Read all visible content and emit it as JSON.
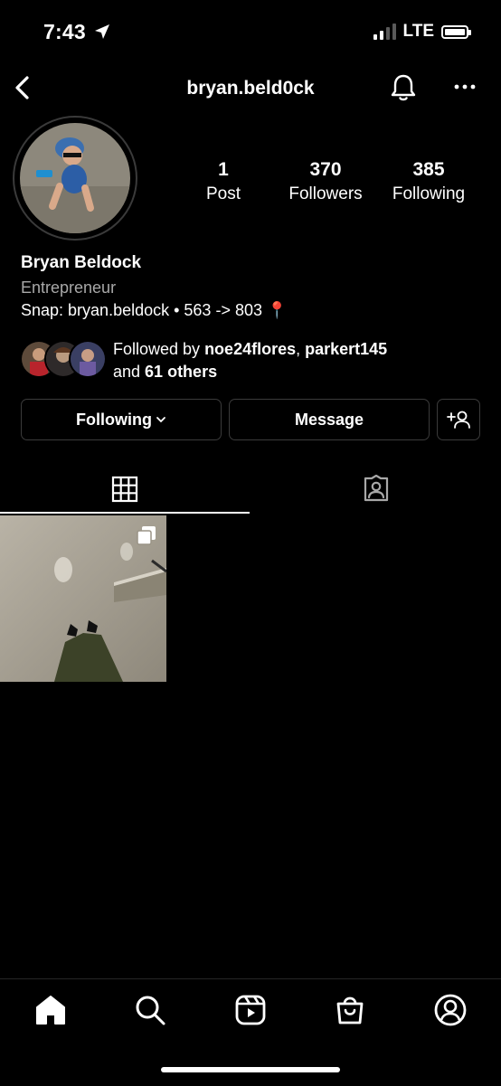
{
  "status_bar": {
    "time": "7:43",
    "network": "LTE",
    "icons": [
      "location-arrow-icon",
      "signal-icon",
      "battery-icon"
    ]
  },
  "nav": {
    "username": "bryan.beld0ck",
    "icons": [
      "back-chevron-icon",
      "bell-icon",
      "more-dots-icon"
    ]
  },
  "profile": {
    "stats": [
      {
        "value": "1",
        "label": "Post"
      },
      {
        "value": "370",
        "label": "Followers"
      },
      {
        "value": "385",
        "label": "Following"
      }
    ],
    "name": "Bryan Beldock",
    "category": "Entrepreneur",
    "bio": "Snap: bryan.beldock • 563 -> 803 📍",
    "followed_by": {
      "prefix": "Followed by ",
      "user1": "noe24flores",
      "separator": ", ",
      "user2": "parkert145",
      "and_text": "and ",
      "others": "61 others"
    }
  },
  "actions": {
    "following_label": "Following",
    "message_label": "Message"
  },
  "tabs": [
    "grid-icon",
    "tagged-icon"
  ],
  "bottom_nav": [
    "home-icon",
    "search-icon",
    "reels-icon",
    "shop-icon",
    "profile-icon"
  ],
  "colors": {
    "background": "#000000",
    "text": "#ffffff",
    "secondary_text": "#a8a8a8",
    "border": "#3b3b3b"
  }
}
